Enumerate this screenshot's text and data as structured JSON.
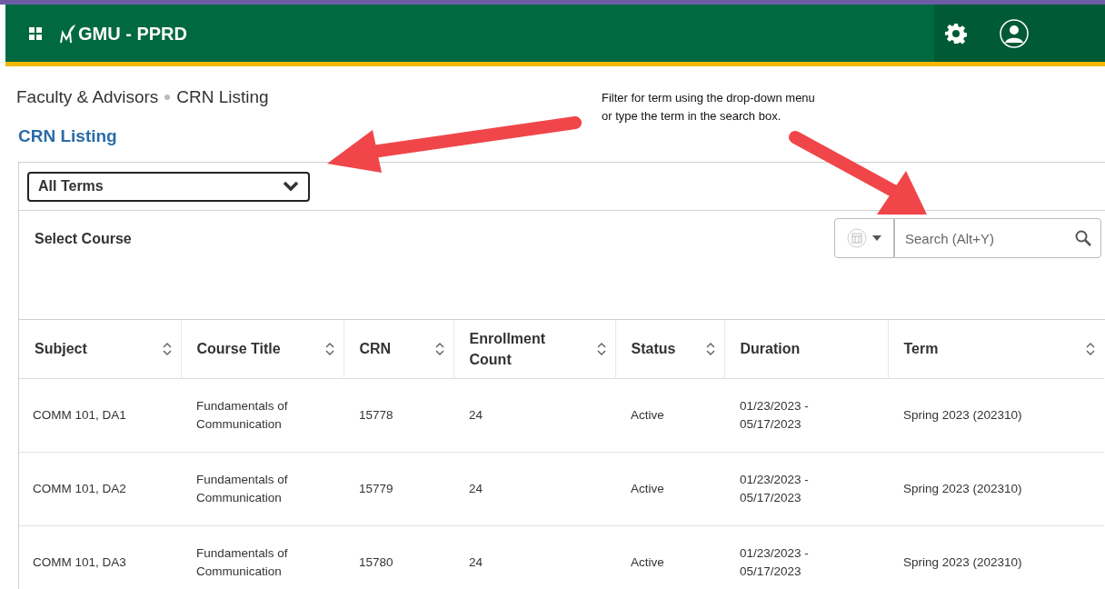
{
  "header": {
    "app_title": "GMU - PPRD"
  },
  "breadcrumb": [
    {
      "label": "Faculty & Advisors"
    },
    {
      "label": "CRN Listing"
    }
  ],
  "page_title": "CRN Listing",
  "term_select": {
    "value": "All Terms"
  },
  "section_title": "Select Course",
  "search": {
    "placeholder": "Search (Alt+Y)"
  },
  "annotation": {
    "text": "Filter for term using the drop-down menu or type the term in the search box."
  },
  "table": {
    "columns": [
      {
        "label": "Subject",
        "sortable": true
      },
      {
        "label": "Course Title",
        "sortable": true
      },
      {
        "label": "CRN",
        "sortable": true
      },
      {
        "label": "Enrollment Count",
        "sortable": true
      },
      {
        "label": "Status",
        "sortable": true
      },
      {
        "label": "Duration",
        "sortable": false
      },
      {
        "label": "Term",
        "sortable": true
      }
    ],
    "rows": [
      [
        "COMM 101, DA1",
        "Fundamentals of Communication",
        "15778",
        "24",
        "Active",
        "01/23/2023 - 05/17/2023",
        "Spring 2023 (202310)"
      ],
      [
        "COMM 101, DA2",
        "Fundamentals of Communication",
        "15779",
        "24",
        "Active",
        "01/23/2023 - 05/17/2023",
        "Spring 2023 (202310)"
      ],
      [
        "COMM 101, DA3",
        "Fundamentals of Communication",
        "15780",
        "24",
        "Active",
        "01/23/2023 - 05/17/2023",
        "Spring 2023 (202310)"
      ]
    ]
  }
}
